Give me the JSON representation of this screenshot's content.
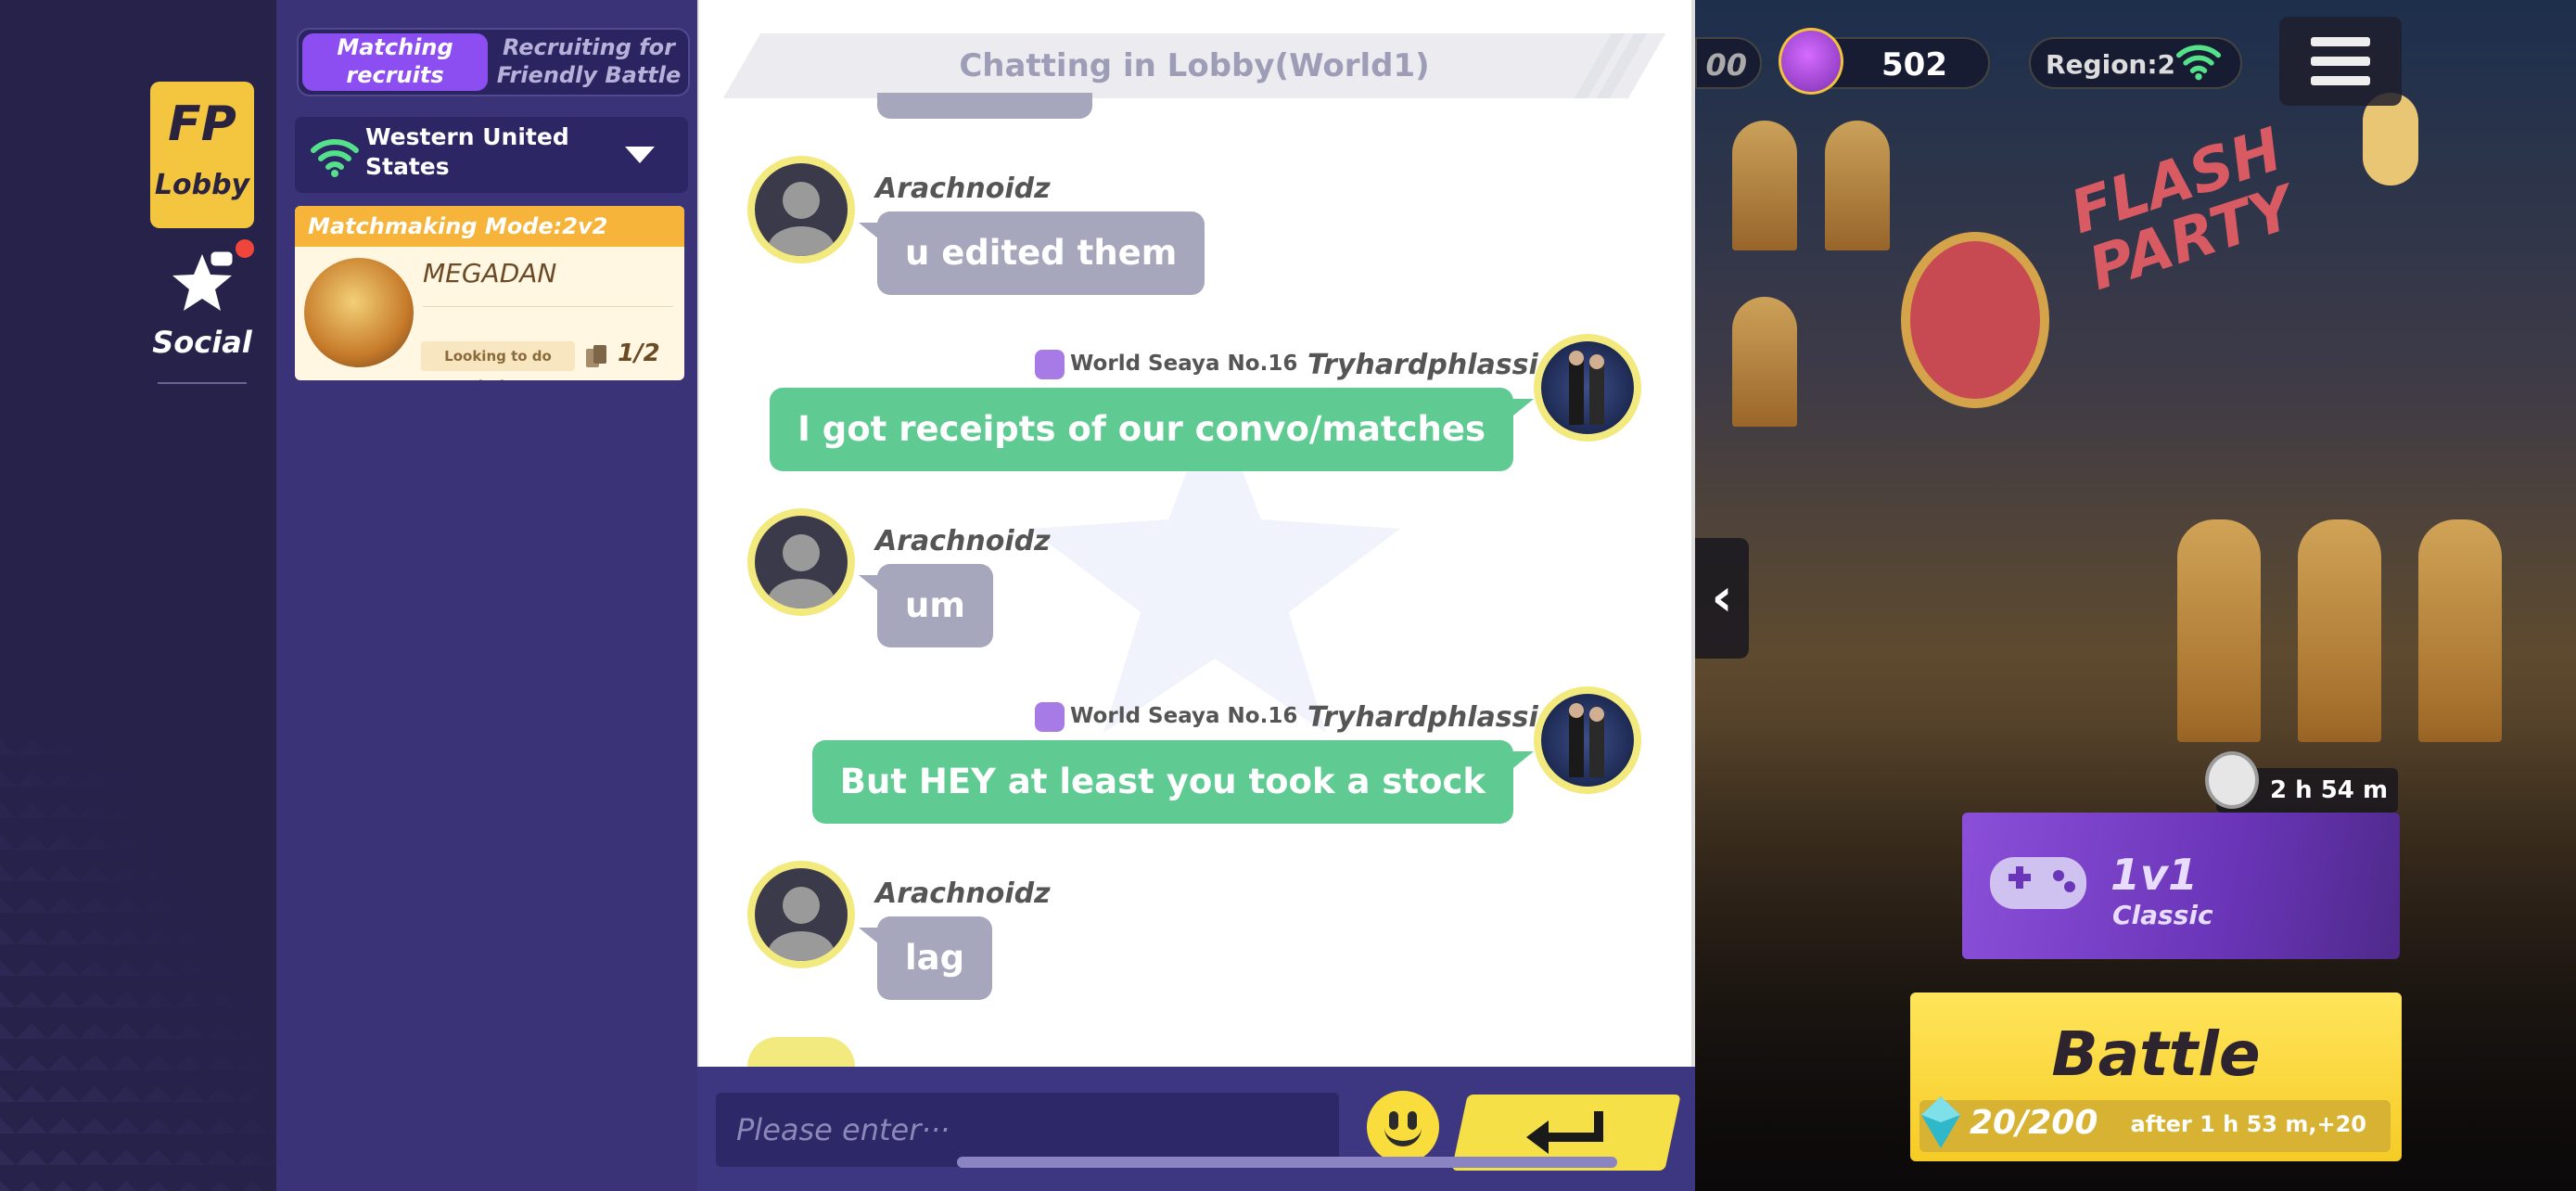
{
  "nav": {
    "lobby_logo": "FP",
    "lobby_label": "Lobby",
    "social_label": "Social"
  },
  "panel": {
    "toggle_active": "Matching recruits",
    "toggle_inactive": "Recruiting for Friendly Battle",
    "region": "Western United States",
    "card": {
      "mode": "Matchmaking Mode:2v2",
      "player": "MEGADAN",
      "tag": "Looking to do missions",
      "count": "1/2"
    }
  },
  "chat": {
    "title": "Chatting in Lobby(World1)",
    "messages": [
      {
        "user": "Arachnoidz",
        "text": "u edited them",
        "side": "left"
      },
      {
        "user": "Tryhardphlassid",
        "title": "World Seaya No.16",
        "text": "I got receipts of our convo/matches",
        "side": "right"
      },
      {
        "user": "Arachnoidz",
        "text": "um",
        "side": "left"
      },
      {
        "user": "Tryhardphlassid",
        "title": "World Seaya No.16",
        "text": "But HEY at least you took a stock",
        "side": "right"
      },
      {
        "user": "Arachnoidz",
        "text": "lag",
        "side": "left"
      }
    ],
    "input_placeholder": "Please enter···"
  },
  "hud": {
    "coins_partial": "00",
    "gems": "502",
    "region": "Region:2",
    "timer": "2 h 54 m",
    "mode_title": "1v1",
    "mode_sub": "Classic",
    "battle_label": "Battle",
    "stamina": "20/200",
    "stamina_refill": "after 1 h 53 m,+20"
  },
  "colors": {
    "accent_purple": "#8c4ef0",
    "chat_green": "#5fcb93",
    "chat_grey": "#a6a6bd",
    "battle_yellow": "#f6cb26",
    "lobby_yellow": "#f4c640"
  },
  "icons": [
    "fp-logo-icon",
    "star-icon",
    "wifi-icon",
    "caret-down-icon",
    "emoji-icon",
    "enter-icon",
    "gem-icon",
    "timer-icon",
    "menu-icon",
    "back-arrow-icon",
    "gamepad-icon"
  ]
}
